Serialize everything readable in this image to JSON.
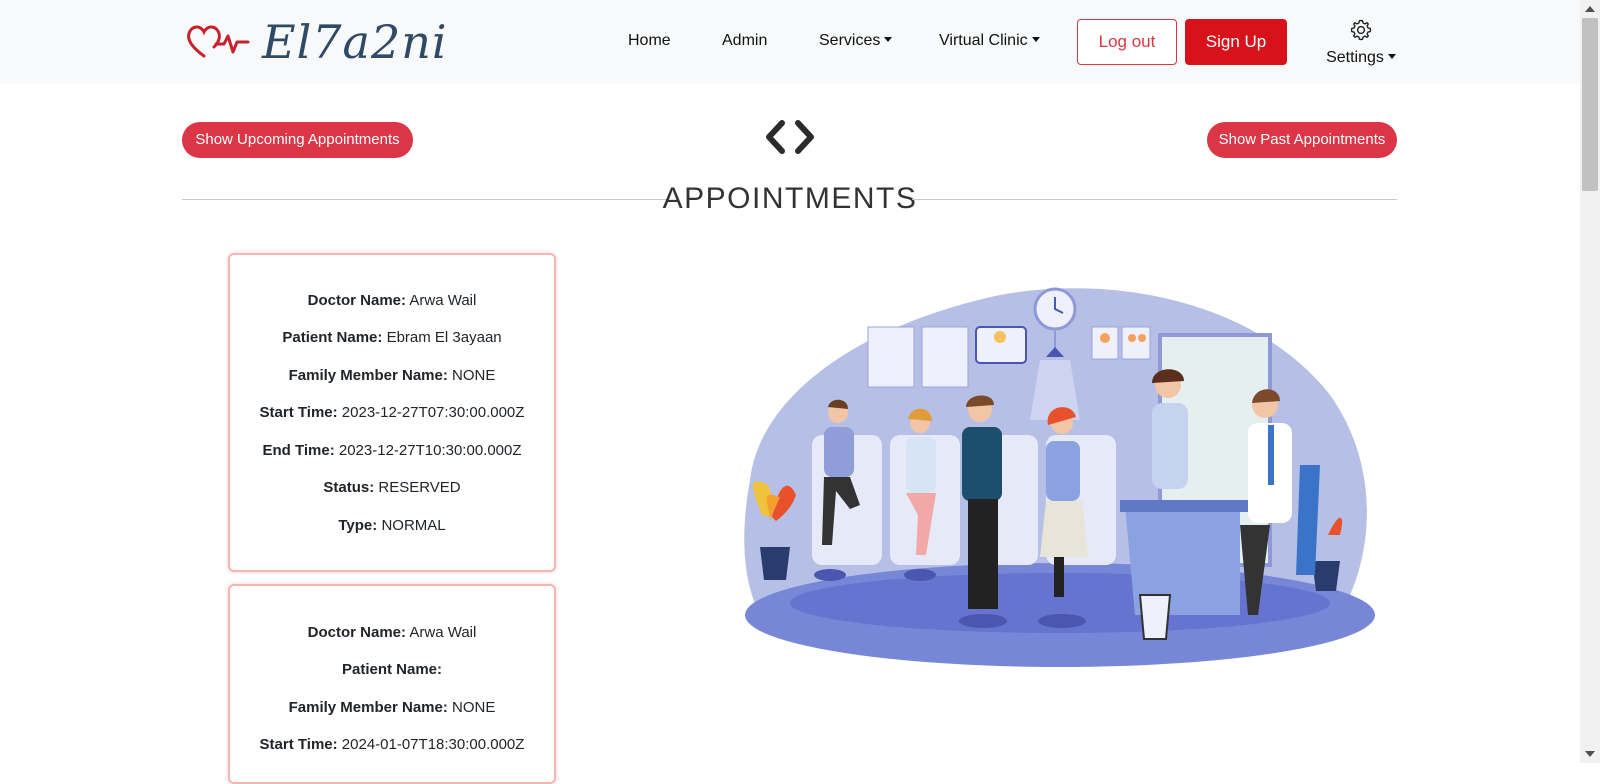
{
  "brand": {
    "name": "El7a2ni"
  },
  "nav": {
    "home": "Home",
    "admin": "Admin",
    "services": "Services",
    "virtual_clinic": "Virtual Clinic",
    "logout": "Log out",
    "signup": "Sign Up",
    "settings": "Settings"
  },
  "actions": {
    "show_upcoming": "Show Upcoming Appointments",
    "show_past": "Show Past Appointments"
  },
  "section_title": "APPOINTMENTS",
  "labels": {
    "doctor": "Doctor Name:",
    "patient": "Patient Name:",
    "family": "Family Member Name:",
    "start": "Start Time:",
    "end": "End Time:",
    "status": "Status:",
    "type": "Type:"
  },
  "appointments": [
    {
      "doctor": "Arwa Wail",
      "patient": "Ebram El 3ayaan",
      "family": "NONE",
      "start": "2023-12-27T07:30:00.000Z",
      "end": "2023-12-27T10:30:00.000Z",
      "status": "RESERVED",
      "type": "NORMAL"
    },
    {
      "doctor": "Arwa Wail",
      "patient": "",
      "family": "NONE",
      "start": "2024-01-07T18:30:00.000Z"
    }
  ],
  "colors": {
    "accent": "#dc3545",
    "signup": "#d8121b",
    "navbar_bg": "#f8f9fa",
    "card_border": "#f3b6b6",
    "illustration_blue": "#b6bfe6"
  }
}
